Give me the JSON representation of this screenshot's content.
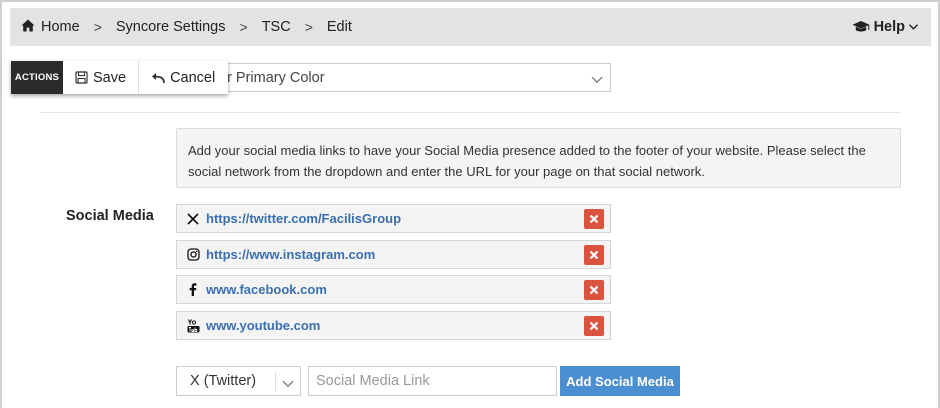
{
  "breadcrumb": {
    "items": [
      "Home",
      "Syncore Settings",
      "TSC",
      "Edit"
    ],
    "separator": ">"
  },
  "help": {
    "label": "Help"
  },
  "actions": {
    "label": "ACTIONS",
    "save": "Save",
    "cancel": "Cancel"
  },
  "color_select": {
    "visible_text": "er Primary Color"
  },
  "info": {
    "text": "Add your social media links to have your Social Media presence added to the footer of your website. Please select the social network from the dropdown and enter the URL for your page on that social network."
  },
  "social_media": {
    "label": "Social Media",
    "links": [
      {
        "network": "x",
        "icon": "x-icon",
        "url": "https://twitter.com/FacilisGroup"
      },
      {
        "network": "instagram",
        "icon": "instagram-icon",
        "url": "https://www.instagram.com"
      },
      {
        "network": "facebook",
        "icon": "facebook-icon",
        "url": "www.facebook.com"
      },
      {
        "network": "youtube",
        "icon": "youtube-icon",
        "url": "www.youtube.com"
      }
    ]
  },
  "add_form": {
    "network_selected": "X (Twitter)",
    "link_placeholder": "Social Media Link",
    "add_label": "Add Social Media"
  },
  "colors": {
    "accent": "#4b8fd1",
    "delete": "#d9533f",
    "link": "#3a6fb0",
    "topbar": "#e3e3e3"
  }
}
